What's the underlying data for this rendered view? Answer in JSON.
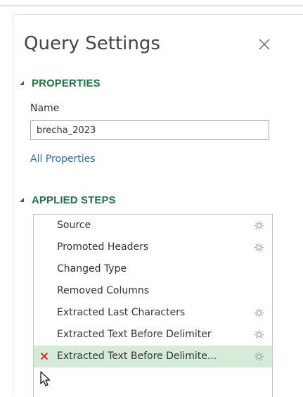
{
  "panel": {
    "title": "Query Settings",
    "close_icon": "close-icon"
  },
  "properties": {
    "header": "PROPERTIES",
    "name_label": "Name",
    "name_value": "brecha_2023",
    "all_properties_link": "All Properties"
  },
  "applied_steps": {
    "header": "APPLIED STEPS",
    "selected_index": 6,
    "steps": [
      {
        "label": "Source",
        "has_settings": true
      },
      {
        "label": "Promoted Headers",
        "has_settings": true
      },
      {
        "label": "Changed Type",
        "has_settings": false
      },
      {
        "label": "Removed Columns",
        "has_settings": false
      },
      {
        "label": "Extracted Last Characters",
        "has_settings": true
      },
      {
        "label": "Extracted Text Before Delimiter",
        "has_settings": true
      },
      {
        "label": "Extracted Text Before Delimite...",
        "has_settings": true
      }
    ]
  },
  "colors": {
    "section_header": "#217346",
    "link": "#2e6da4",
    "selected_row": "#d5ecd8",
    "delete_icon": "#d13438"
  },
  "icons": {
    "collapse": "collapse-triangle-icon",
    "settings": "gear-icon",
    "delete": "delete-x-icon",
    "cursor": "mouse-pointer-icon"
  }
}
